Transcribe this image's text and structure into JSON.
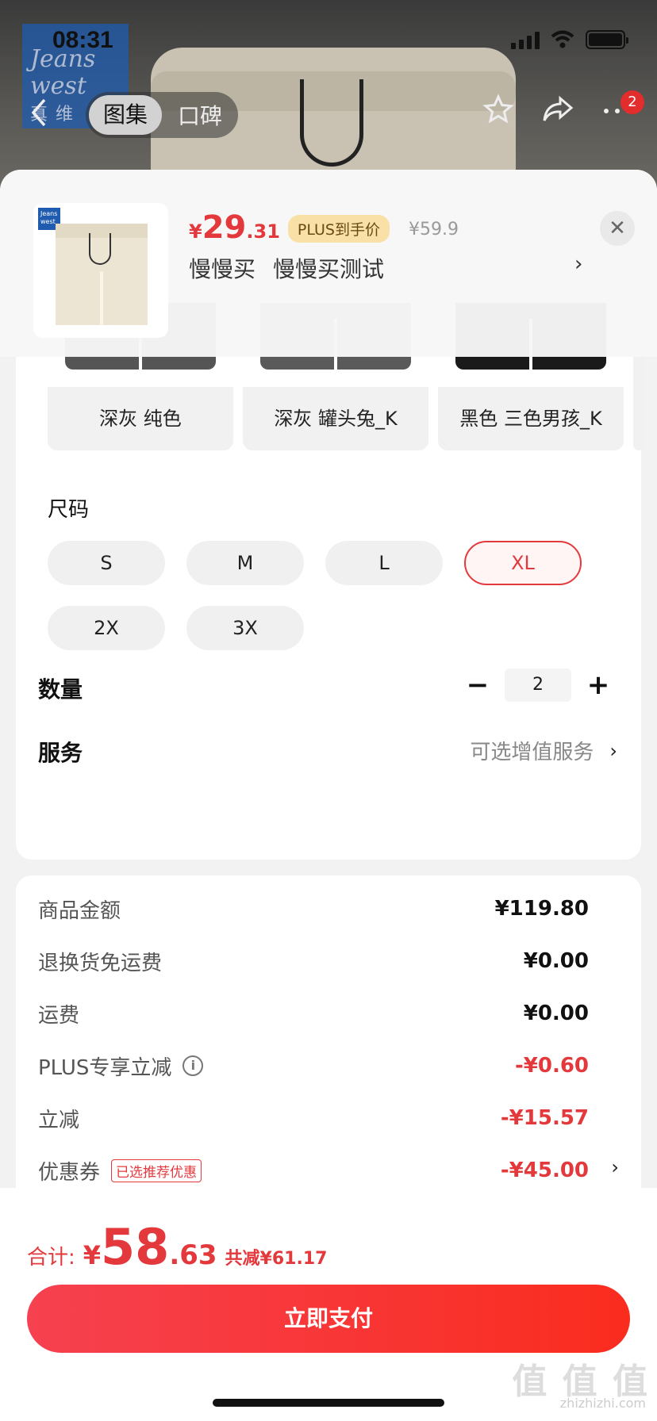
{
  "status_bar": {
    "time": "08:31"
  },
  "background": {
    "brand_logo": {
      "line1": "Jeans",
      "line2": "west",
      "cn": "真维"
    }
  },
  "nav": {
    "back_icon": "chevron-left-icon",
    "tabs": [
      {
        "label": "图集",
        "active": true
      },
      {
        "label": "口碑",
        "active": false
      }
    ],
    "star_icon": "star-icon",
    "share_icon": "share-icon",
    "more_icon": "more-icon",
    "badge_count": "2"
  },
  "product": {
    "thumb_logo": "Jeans west",
    "price_symbol": "¥",
    "price_int": "29",
    "price_dec": ".31",
    "plus_tag": "PLUS到手价",
    "original_price": "¥59.9",
    "tags": [
      "慢慢买",
      "慢慢买测试"
    ],
    "close_icon": "close-icon"
  },
  "colors": {
    "options": [
      {
        "label": "深灰 纯色",
        "swatch": "#555555"
      },
      {
        "label": "深灰 罐头兔_K",
        "swatch": "#5a5a5a"
      },
      {
        "label": "黑色 三色男孩_K",
        "swatch": "#1a1a1a"
      }
    ]
  },
  "size": {
    "title": "尺码",
    "options": [
      "S",
      "M",
      "L",
      "XL",
      "2X",
      "3X"
    ],
    "selected": "XL"
  },
  "quantity": {
    "label": "数量",
    "minus": "−",
    "value": "2",
    "plus": "+"
  },
  "service": {
    "label": "服务",
    "value": "可选增值服务",
    "chevron": "›"
  },
  "breakdown": [
    {
      "label": "商品金额",
      "value": "¥119.80",
      "red": false
    },
    {
      "label": "退换货免运费",
      "value": "¥0.00",
      "red": false
    },
    {
      "label": "运费",
      "value": "¥0.00",
      "red": false
    },
    {
      "label": "PLUS专享立减",
      "value": "-¥0.60",
      "red": true,
      "info": "i"
    },
    {
      "label": "立减",
      "value": "-¥15.57",
      "red": true
    },
    {
      "label": "优惠券",
      "value": "-¥45.00",
      "red": true,
      "tag": "已选推荐优惠"
    }
  ],
  "total": {
    "label": "合计:",
    "symbol": "¥",
    "int": "58",
    "dec": ".63",
    "savings": "共减¥61.17"
  },
  "pay_button": "立即支付",
  "watermark": {
    "main": "值 值 值",
    "sub": "zhizhizhi.com"
  },
  "colors_theme": {
    "accent": "#e4393c",
    "pay_gradient_start": "#f64150",
    "pay_gradient_end": "#fa2c1e"
  }
}
